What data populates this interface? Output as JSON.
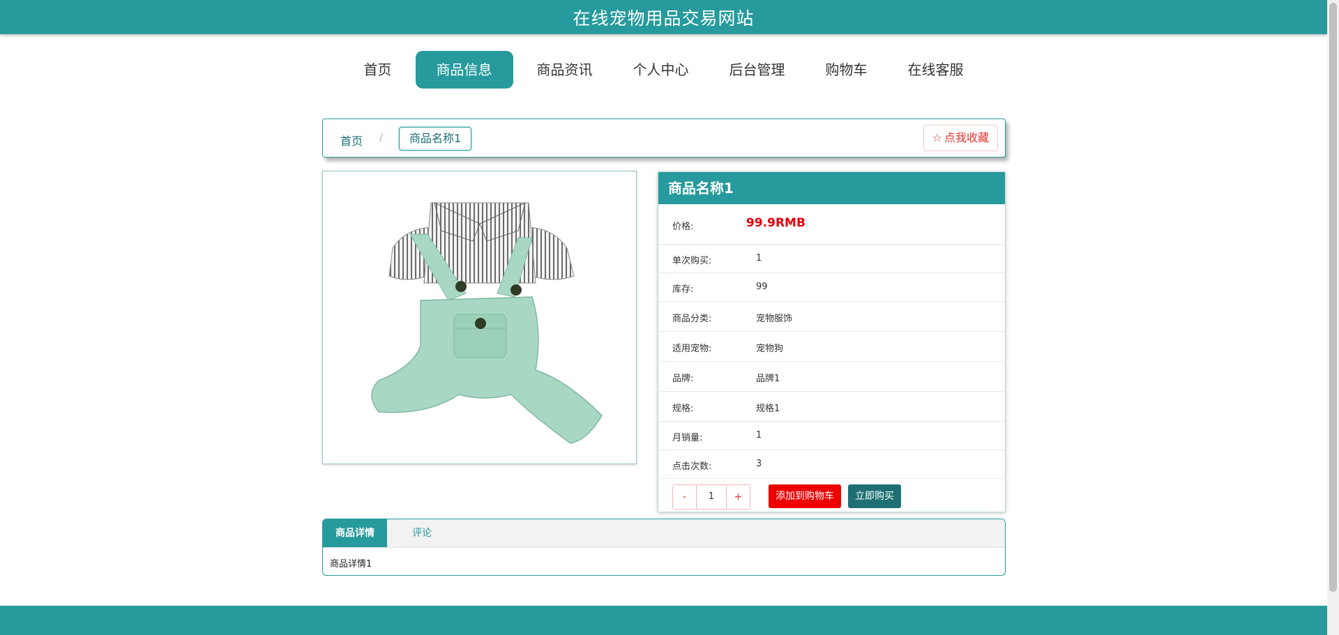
{
  "header": {
    "site_title": "在线宠物用品交易网站"
  },
  "nav": {
    "items": [
      {
        "label": "首页"
      },
      {
        "label": "商品信息",
        "active": true
      },
      {
        "label": "商品资讯"
      },
      {
        "label": "个人中心"
      },
      {
        "label": "后台管理"
      },
      {
        "label": "购物车"
      },
      {
        "label": "在线客服"
      }
    ]
  },
  "breadcrumb": {
    "home": "首页",
    "separator": "/",
    "current": "商品名称1"
  },
  "favorite": {
    "icon": "star-outline-icon",
    "label": "点我收藏"
  },
  "product": {
    "image_alt": "宠物服饰",
    "name": "商品名称1",
    "fields": {
      "price_label": "价格:",
      "price_value": "99.9RMB",
      "single_buy_label": "单次购买:",
      "single_buy_value": "1",
      "stock_label": "库存:",
      "stock_value": "99",
      "category_label": "商品分类:",
      "category_value": "宠物服饰",
      "pet_label": "适用宠物:",
      "pet_value": "宠物狗",
      "brand_label": "品牌:",
      "brand_value": "品牌1",
      "spec_label": "规格:",
      "spec_value": "规格1",
      "monthly_sales_label": "月销量:",
      "monthly_sales_value": "1",
      "clicks_label": "点击次数:",
      "clicks_value": "3"
    }
  },
  "quantity": {
    "minus": "-",
    "value": "1",
    "plus": "+"
  },
  "actions": {
    "add_to_cart": "添加到购物车",
    "buy_now": "立即购买"
  },
  "tabs": {
    "items": [
      {
        "label": "商品详情",
        "active": true
      },
      {
        "label": "评论"
      }
    ],
    "content": "商品详情1"
  },
  "colors": {
    "primary": "#269a9c",
    "dark_teal": "#1e6f73",
    "price_red": "#e3000b",
    "cart_red": "#ee0000"
  }
}
